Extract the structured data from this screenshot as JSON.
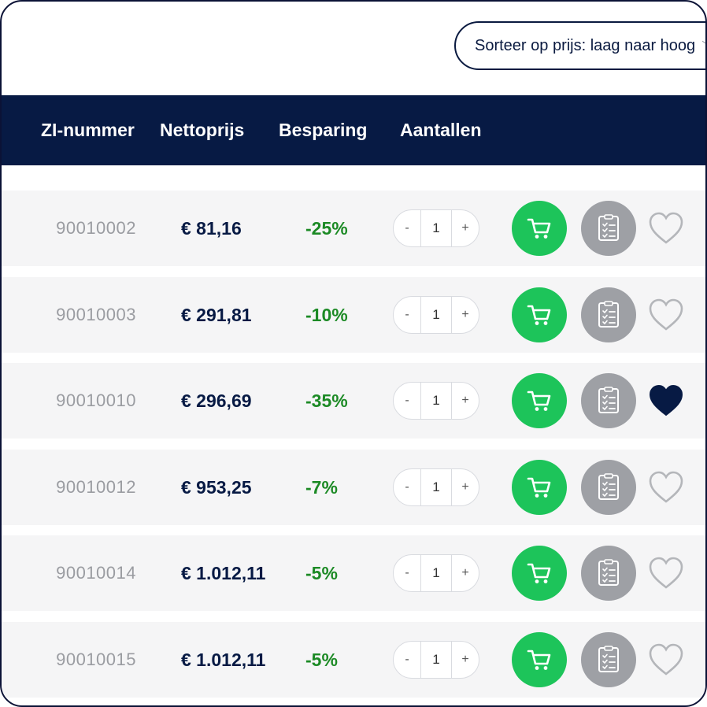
{
  "sort": {
    "label": "Sorteer op prijs: laag naar hoog",
    "icon": "chevron-down-icon"
  },
  "table": {
    "columns": [
      "ZI-nummer",
      "Nettoprijs",
      "Besparing",
      "Aantallen"
    ],
    "qty_minus": "-",
    "qty_plus": "+",
    "rows": [
      {
        "zi": "90010002",
        "price": "€ 81,16",
        "saving": "-25%",
        "qty": "1",
        "favorite": false
      },
      {
        "zi": "90010003",
        "price": "€ 291,81",
        "saving": "-10%",
        "qty": "1",
        "favorite": false
      },
      {
        "zi": "90010010",
        "price": "€ 296,69",
        "saving": "-35%",
        "qty": "1",
        "favorite": true
      },
      {
        "zi": "90010012",
        "price": "€ 953,25",
        "saving": "-7%",
        "qty": "1",
        "favorite": false
      },
      {
        "zi": "90010014",
        "price": "€ 1.012,11",
        "saving": "-5%",
        "qty": "1",
        "favorite": false
      },
      {
        "zi": "90010015",
        "price": "€ 1.012,11",
        "saving": "-5%",
        "qty": "1",
        "favorite": false
      }
    ]
  },
  "colors": {
    "header_bg": "#071a44",
    "cart_green": "#1dc45a",
    "list_gray": "#9ea0a5",
    "saving_green": "#1c8a25",
    "heart_filled": "#071a44",
    "heart_outline": "#b4b6ba"
  },
  "icons": [
    "cart-icon",
    "list-icon",
    "heart-icon"
  ]
}
